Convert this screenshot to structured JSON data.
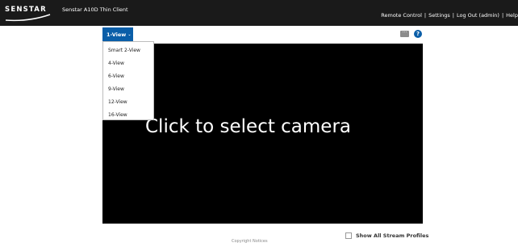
{
  "header": {
    "logo_text": "SENSTAR",
    "app_title": "Senstar A10D Thin Client",
    "nav": {
      "remote_control": "Remote Control",
      "settings": "Settings",
      "logout": "Log Out (admin)",
      "help": "Help",
      "separator": "|"
    }
  },
  "toolbar": {
    "view_selector_label": "1-View",
    "more_label": "···",
    "help_label": "?"
  },
  "view_menu": {
    "items": [
      "Smart 2-View",
      "4-View",
      "6-View",
      "9-View",
      "12-View",
      "16-View"
    ]
  },
  "video": {
    "message": "Click to select camera"
  },
  "footer": {
    "show_all_stream_profiles": "Show All Stream Profiles",
    "show_all_stream_profiles_checked": false,
    "copyright": "Copyright Notices"
  },
  "colors": {
    "topbar": "#1a1a1a",
    "accent": "#0a5ea8",
    "video_bg": "#000000"
  }
}
